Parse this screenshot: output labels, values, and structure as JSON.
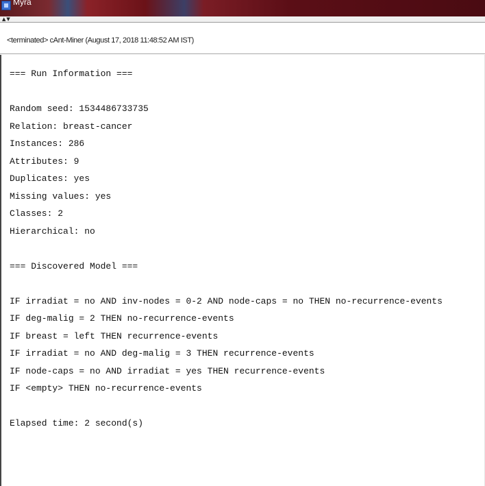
{
  "window": {
    "title": "Myra"
  },
  "console": {
    "label": "<terminated> cAnt-Miner (August 17, 2018 11:48:52 AM IST)"
  },
  "output": {
    "lines": [
      "=== Run Information ===",
      "",
      "Random seed: 1534486733735",
      "Relation: breast-cancer",
      "Instances: 286",
      "Attributes: 9",
      "Duplicates: yes",
      "Missing values: yes",
      "Classes: 2",
      "Hierarchical: no",
      "",
      "=== Discovered Model ===",
      "",
      "IF irradiat = no AND inv-nodes = 0-2 AND node-caps = no THEN no-recurrence-events",
      "IF deg-malig = 2 THEN no-recurrence-events",
      "IF breast = left THEN recurrence-events",
      "IF irradiat = no AND deg-malig = 3 THEN recurrence-events",
      "IF node-caps = no AND irradiat = yes THEN recurrence-events",
      "IF <empty> THEN no-recurrence-events",
      "",
      "Elapsed time: 2 second(s)"
    ]
  },
  "icons": {
    "app": "app-icon",
    "view-controls": "minimize-maximize-icon"
  }
}
